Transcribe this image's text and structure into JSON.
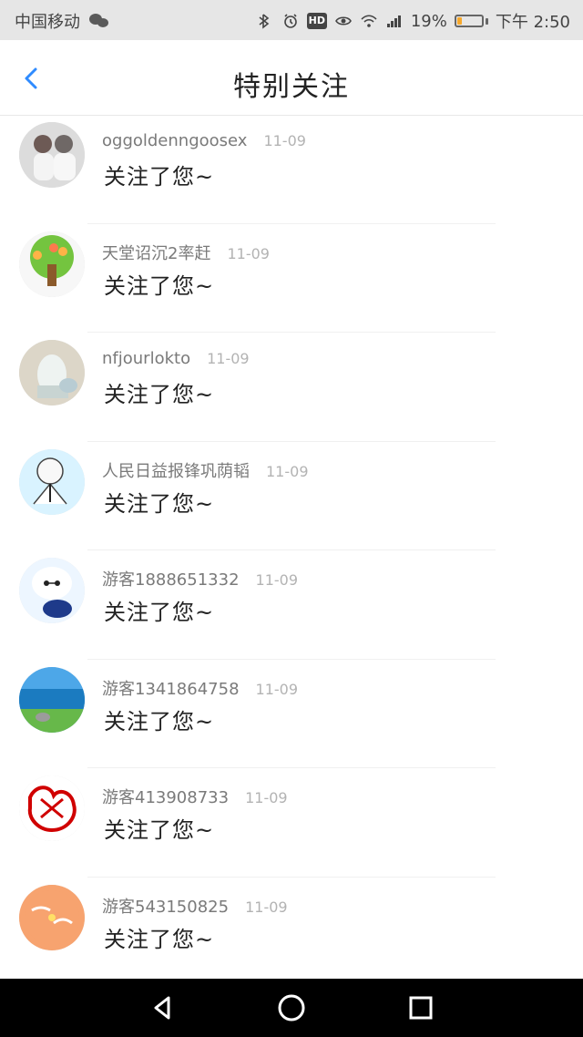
{
  "status_bar": {
    "carrier": "中国移动",
    "battery_percent": "19%",
    "time": "下午 2:50",
    "battery_level": 0.19,
    "icons": [
      "wechat-icon",
      "bluetooth-icon",
      "alarm-icon",
      "hd-icon",
      "eye-icon",
      "wifi-icon",
      "signal-icon",
      "battery-icon"
    ]
  },
  "header": {
    "title": "特别关注"
  },
  "list": {
    "items": [
      {
        "name": "oggoldenngoosex",
        "date": "11-09",
        "message": "关注了您~",
        "avatar": "avatar-0"
      },
      {
        "name": "天堂诏沉2率赶",
        "date": "11-09",
        "message": "关注了您~",
        "avatar": "avatar-1"
      },
      {
        "name": "nfjourlokto",
        "date": "11-09",
        "message": "关注了您~",
        "avatar": "avatar-2"
      },
      {
        "name": "人民日益报锋巩荫韬",
        "date": "11-09",
        "message": "关注了您~",
        "avatar": "avatar-3"
      },
      {
        "name": "游客1888651332",
        "date": "11-09",
        "message": "关注了您~",
        "avatar": "avatar-4"
      },
      {
        "name": "游客1341864758",
        "date": "11-09",
        "message": "关注了您~",
        "avatar": "avatar-5"
      },
      {
        "name": "游客413908733",
        "date": "11-09",
        "message": "关注了您~",
        "avatar": "avatar-6"
      },
      {
        "name": "游客543150825",
        "date": "11-09",
        "message": "关注了您~",
        "avatar": "avatar-7"
      }
    ]
  },
  "navigation": {
    "back_icon": "triangle-back-icon",
    "home_icon": "circle-home-icon",
    "recent_icon": "square-recent-icon"
  },
  "colors": {
    "accent": "#2f8bff",
    "battery": "#f7a82b",
    "nav_background": "#000000",
    "status_background": "#e6e6e6"
  }
}
